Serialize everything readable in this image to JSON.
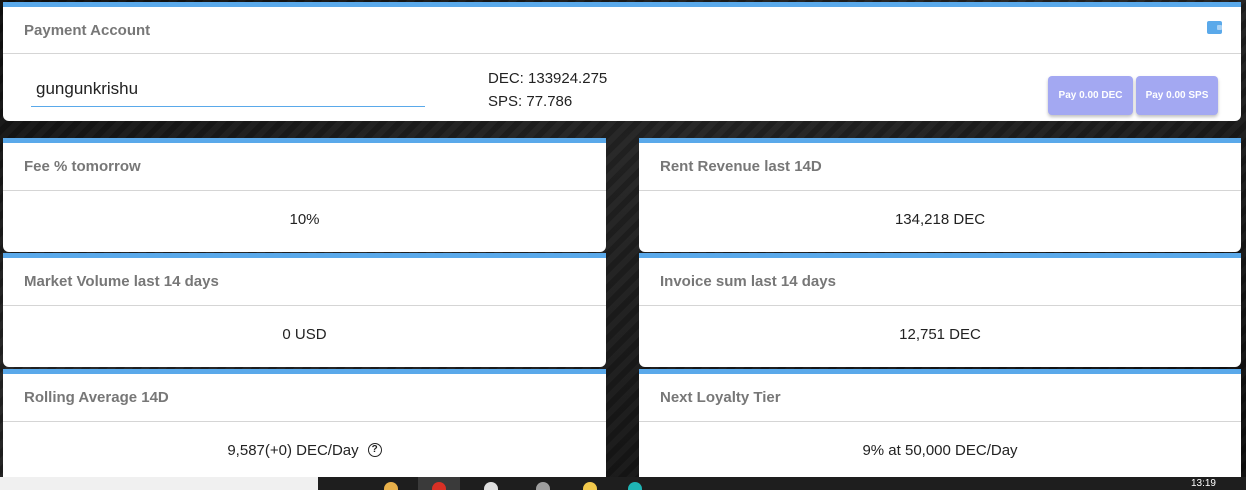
{
  "payment": {
    "title": "Payment Account",
    "account": "gungunkrishu",
    "dec_balance": "DEC: 133924.275",
    "sps_balance": "SPS: 77.786",
    "pay_dec_label": "Pay 0.00 DEC",
    "pay_sps_label": "Pay 0.00 SPS",
    "icon": "wallet-icon"
  },
  "stats": {
    "fee": {
      "title": "Fee % tomorrow",
      "value": "10%"
    },
    "rent_revenue": {
      "title": "Rent Revenue last 14D",
      "value": "134,218 DEC"
    },
    "market_volume": {
      "title": "Market Volume last 14 days",
      "value": "0 USD"
    },
    "invoice_sum": {
      "title": "Invoice sum last 14 days",
      "value": "12,751 DEC"
    },
    "rolling_average": {
      "title": "Rolling Average 14D",
      "value": "9,587(+0) DEC/Day",
      "help_icon": "?"
    },
    "loyalty": {
      "title": "Next Loyalty Tier",
      "value": "9% at 50,000 DEC/Day"
    }
  },
  "taskbar": {
    "clock": "13:19"
  },
  "colors": {
    "accent": "#5aa9ea",
    "button": "#a3a8f2"
  }
}
